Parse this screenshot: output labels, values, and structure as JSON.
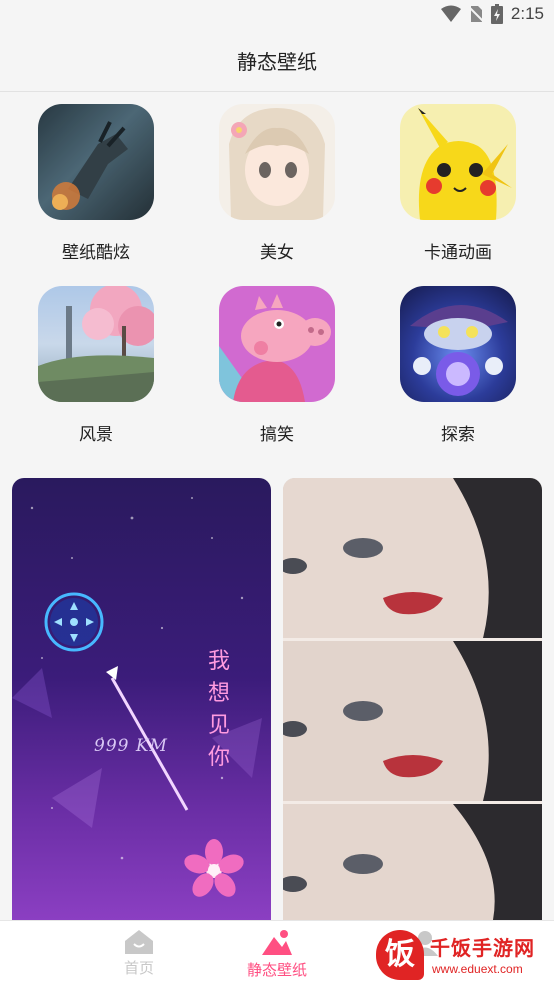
{
  "status_bar": {
    "time": "2:15",
    "icons": [
      "wifi-icon",
      "no-sim-icon",
      "battery-icon"
    ]
  },
  "app_bar": {
    "title": "静态壁纸"
  },
  "categories": [
    {
      "label": "壁纸酷炫",
      "icon": "cool-wallpaper-thumbnail"
    },
    {
      "label": "美女",
      "icon": "anime-girl-thumbnail"
    },
    {
      "label": "卡通动画",
      "icon": "pikachu-thumbnail"
    },
    {
      "label": "风景",
      "icon": "cherry-blossom-scenery-thumbnail"
    },
    {
      "label": "搞笑",
      "icon": "peppa-pig-thumbnail"
    },
    {
      "label": "探索",
      "icon": "wizard-creature-thumbnail"
    }
  ],
  "wallpapers": {
    "left": {
      "distance_text": "999 KM",
      "vertical_text": [
        "我",
        "想",
        "见",
        "你"
      ]
    },
    "right": {
      "description": "photo-collage"
    }
  },
  "bottom_nav": {
    "items": [
      {
        "label": "首页",
        "icon": "home-icon",
        "active": false
      },
      {
        "label": "静态壁纸",
        "icon": "wallpaper-icon",
        "active": true
      },
      {
        "label": "",
        "icon": "profile-icon",
        "active": false
      }
    ],
    "active_color": "#ff4f82",
    "inactive_color": "#c8c8c8"
  },
  "watermark": {
    "char": "饭",
    "name": "千饭手游网",
    "url": "www.eduext.com"
  }
}
